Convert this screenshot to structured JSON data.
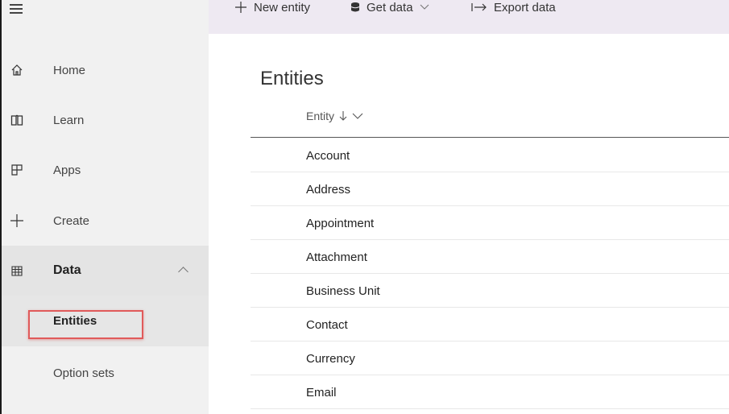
{
  "command_bar": {
    "new_entity": "New entity",
    "get_data": "Get data",
    "export_data": "Export data"
  },
  "sidebar": {
    "items": [
      {
        "label": "Home",
        "icon": "home-icon"
      },
      {
        "label": "Learn",
        "icon": "book-icon"
      },
      {
        "label": "Apps",
        "icon": "apps-icon"
      },
      {
        "label": "Create",
        "icon": "plus-icon"
      },
      {
        "label": "Data",
        "icon": "table-icon",
        "expanded": true
      }
    ],
    "subitems": [
      {
        "label": "Entities",
        "selected": true
      },
      {
        "label": "Option sets",
        "selected": false
      }
    ]
  },
  "main": {
    "title": "Entities",
    "column_header": "Entity",
    "rows": [
      "Account",
      "Address",
      "Appointment",
      "Attachment",
      "Business Unit",
      "Contact",
      "Currency",
      "Email"
    ]
  },
  "colors": {
    "highlight": "#e05a5a",
    "command_bar_bg": "#eee9f2",
    "sidebar_bg": "#f1f1f1"
  }
}
